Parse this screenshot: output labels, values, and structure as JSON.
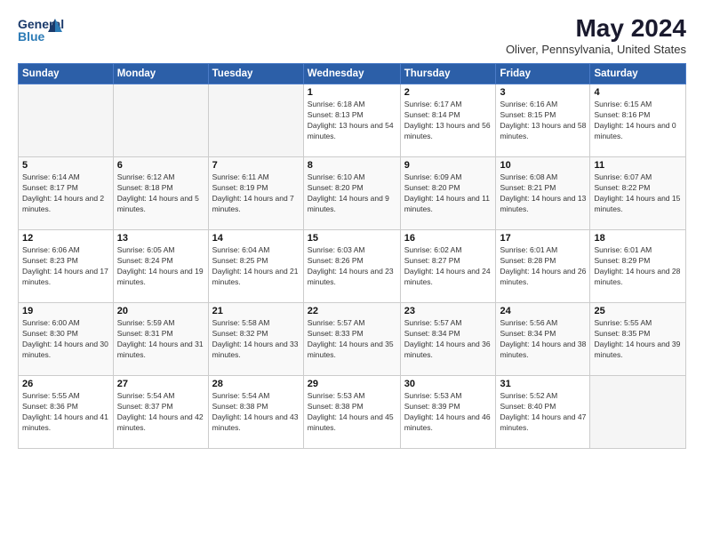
{
  "logo": {
    "line1": "General",
    "line2": "Blue"
  },
  "title": "May 2024",
  "location": "Oliver, Pennsylvania, United States",
  "days_of_week": [
    "Sunday",
    "Monday",
    "Tuesday",
    "Wednesday",
    "Thursday",
    "Friday",
    "Saturday"
  ],
  "weeks": [
    [
      {
        "day": "",
        "empty": true
      },
      {
        "day": "",
        "empty": true
      },
      {
        "day": "",
        "empty": true
      },
      {
        "day": "1",
        "sunrise": "6:18 AM",
        "sunset": "8:13 PM",
        "daylight": "13 hours and 54 minutes."
      },
      {
        "day": "2",
        "sunrise": "6:17 AM",
        "sunset": "8:14 PM",
        "daylight": "13 hours and 56 minutes."
      },
      {
        "day": "3",
        "sunrise": "6:16 AM",
        "sunset": "8:15 PM",
        "daylight": "13 hours and 58 minutes."
      },
      {
        "day": "4",
        "sunrise": "6:15 AM",
        "sunset": "8:16 PM",
        "daylight": "14 hours and 0 minutes."
      }
    ],
    [
      {
        "day": "5",
        "sunrise": "6:14 AM",
        "sunset": "8:17 PM",
        "daylight": "14 hours and 2 minutes."
      },
      {
        "day": "6",
        "sunrise": "6:12 AM",
        "sunset": "8:18 PM",
        "daylight": "14 hours and 5 minutes."
      },
      {
        "day": "7",
        "sunrise": "6:11 AM",
        "sunset": "8:19 PM",
        "daylight": "14 hours and 7 minutes."
      },
      {
        "day": "8",
        "sunrise": "6:10 AM",
        "sunset": "8:20 PM",
        "daylight": "14 hours and 9 minutes."
      },
      {
        "day": "9",
        "sunrise": "6:09 AM",
        "sunset": "8:20 PM",
        "daylight": "14 hours and 11 minutes."
      },
      {
        "day": "10",
        "sunrise": "6:08 AM",
        "sunset": "8:21 PM",
        "daylight": "14 hours and 13 minutes."
      },
      {
        "day": "11",
        "sunrise": "6:07 AM",
        "sunset": "8:22 PM",
        "daylight": "14 hours and 15 minutes."
      }
    ],
    [
      {
        "day": "12",
        "sunrise": "6:06 AM",
        "sunset": "8:23 PM",
        "daylight": "14 hours and 17 minutes."
      },
      {
        "day": "13",
        "sunrise": "6:05 AM",
        "sunset": "8:24 PM",
        "daylight": "14 hours and 19 minutes."
      },
      {
        "day": "14",
        "sunrise": "6:04 AM",
        "sunset": "8:25 PM",
        "daylight": "14 hours and 21 minutes."
      },
      {
        "day": "15",
        "sunrise": "6:03 AM",
        "sunset": "8:26 PM",
        "daylight": "14 hours and 23 minutes."
      },
      {
        "day": "16",
        "sunrise": "6:02 AM",
        "sunset": "8:27 PM",
        "daylight": "14 hours and 24 minutes."
      },
      {
        "day": "17",
        "sunrise": "6:01 AM",
        "sunset": "8:28 PM",
        "daylight": "14 hours and 26 minutes."
      },
      {
        "day": "18",
        "sunrise": "6:01 AM",
        "sunset": "8:29 PM",
        "daylight": "14 hours and 28 minutes."
      }
    ],
    [
      {
        "day": "19",
        "sunrise": "6:00 AM",
        "sunset": "8:30 PM",
        "daylight": "14 hours and 30 minutes."
      },
      {
        "day": "20",
        "sunrise": "5:59 AM",
        "sunset": "8:31 PM",
        "daylight": "14 hours and 31 minutes."
      },
      {
        "day": "21",
        "sunrise": "5:58 AM",
        "sunset": "8:32 PM",
        "daylight": "14 hours and 33 minutes."
      },
      {
        "day": "22",
        "sunrise": "5:57 AM",
        "sunset": "8:33 PM",
        "daylight": "14 hours and 35 minutes."
      },
      {
        "day": "23",
        "sunrise": "5:57 AM",
        "sunset": "8:34 PM",
        "daylight": "14 hours and 36 minutes."
      },
      {
        "day": "24",
        "sunrise": "5:56 AM",
        "sunset": "8:34 PM",
        "daylight": "14 hours and 38 minutes."
      },
      {
        "day": "25",
        "sunrise": "5:55 AM",
        "sunset": "8:35 PM",
        "daylight": "14 hours and 39 minutes."
      }
    ],
    [
      {
        "day": "26",
        "sunrise": "5:55 AM",
        "sunset": "8:36 PM",
        "daylight": "14 hours and 41 minutes."
      },
      {
        "day": "27",
        "sunrise": "5:54 AM",
        "sunset": "8:37 PM",
        "daylight": "14 hours and 42 minutes."
      },
      {
        "day": "28",
        "sunrise": "5:54 AM",
        "sunset": "8:38 PM",
        "daylight": "14 hours and 43 minutes."
      },
      {
        "day": "29",
        "sunrise": "5:53 AM",
        "sunset": "8:38 PM",
        "daylight": "14 hours and 45 minutes."
      },
      {
        "day": "30",
        "sunrise": "5:53 AM",
        "sunset": "8:39 PM",
        "daylight": "14 hours and 46 minutes."
      },
      {
        "day": "31",
        "sunrise": "5:52 AM",
        "sunset": "8:40 PM",
        "daylight": "14 hours and 47 minutes."
      },
      {
        "day": "",
        "empty": true
      }
    ]
  ]
}
